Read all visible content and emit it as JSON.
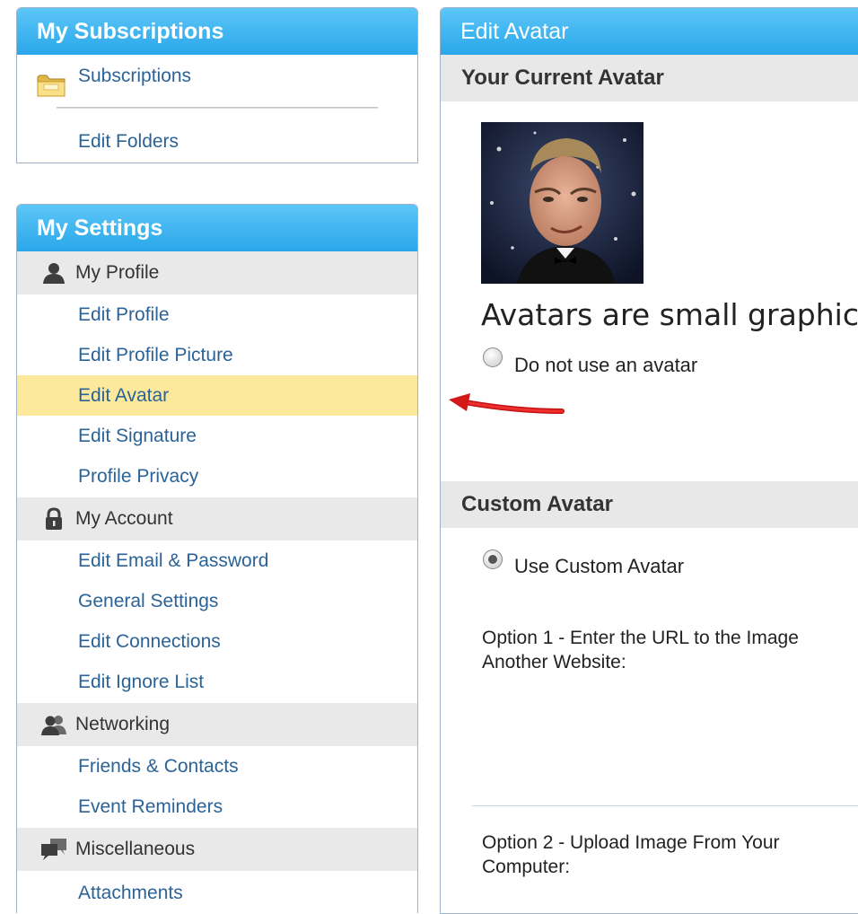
{
  "subscriptions_panel": {
    "title": "My Subscriptions",
    "items": [
      {
        "label": "Subscriptions",
        "icon": "folder-icon"
      },
      {
        "label": "Edit Folders"
      }
    ]
  },
  "settings_panel": {
    "title": "My Settings",
    "sections": [
      {
        "label": "My Profile",
        "icon": "person-icon",
        "items": [
          "Edit Profile",
          "Edit Profile Picture",
          "Edit Avatar",
          "Edit Signature",
          "Profile Privacy"
        ]
      },
      {
        "label": "My Account",
        "icon": "lock-icon",
        "items": [
          "Edit Email & Password",
          "General Settings",
          "Edit Connections",
          "Edit Ignore List"
        ]
      },
      {
        "label": "Networking",
        "icon": "people-icon",
        "items": [
          "Friends & Contacts",
          "Event Reminders"
        ]
      },
      {
        "label": "Miscellaneous",
        "icon": "chat-icon",
        "items": [
          "Attachments"
        ]
      }
    ],
    "active_item": "Edit Avatar"
  },
  "edit_panel": {
    "title": "Edit Avatar",
    "current_avatar_heading": "Your Current Avatar",
    "avatar_description": "Avatars are small graphics t",
    "no_avatar_label": "Do not use an avatar",
    "custom_avatar_heading": "Custom Avatar",
    "use_custom_label": "Use Custom Avatar",
    "option1_text": "Option 1 - Enter the URL to the Image Another Website:",
    "option2_text": "Option 2 - Upload Image From Your Computer:"
  },
  "colors": {
    "header_gradient_top": "#5cc6f7",
    "header_gradient_bottom": "#2aa7ea",
    "link": "#2b6398",
    "active_row": "#fce99b",
    "section_row": "#e9e9e9",
    "arrow": "#e11b1b"
  }
}
